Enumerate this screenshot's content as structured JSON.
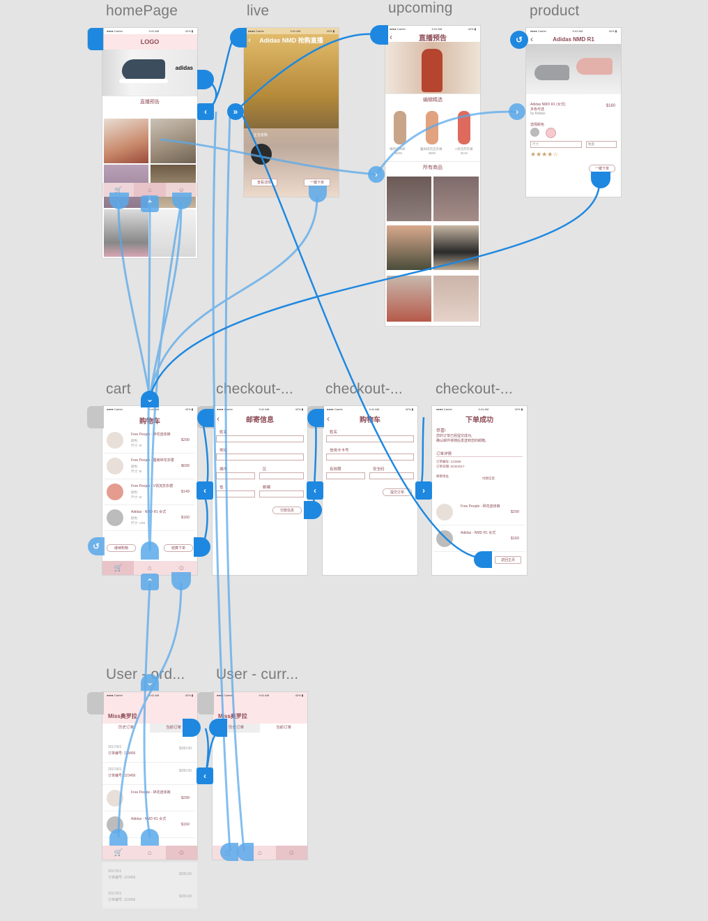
{
  "artboards": {
    "home": {
      "label": "homePage",
      "logo": "LOGO",
      "section": "直播预告",
      "nike_text": "adidas"
    },
    "live": {
      "label": "live",
      "title": "Adidas NMD 抢购直播",
      "now_live": "正在抢购",
      "view_details": "查看详情",
      "buy_now": "一键下单"
    },
    "upcoming": {
      "label": "upcoming",
      "title": "直播预告",
      "picks": "编辑精选",
      "all": "所有商品",
      "items": [
        {
          "name": "嘻哈连体裤",
          "price": "$299"
        },
        {
          "name": "露肩碎花连衣裙",
          "price": "$699"
        },
        {
          "name": "V领流苏衣裙",
          "price": "$149"
        }
      ]
    },
    "product": {
      "label": "product",
      "title": "Adidas NMD R1",
      "name": "Adidas NMD R1 (女式)",
      "variant": "多色可选",
      "brand": "by Adidas",
      "price": "$160",
      "color_label": "选择颜色",
      "size_ph": "尺寸",
      "qty_ph": "数量",
      "stars": "★★★★☆",
      "buy": "一键下单"
    },
    "cart": {
      "label": "cart",
      "title": "购物车",
      "items": [
        {
          "name": "Free People - 碎花连体裤",
          "color": "颜色:",
          "size": "尺寸: M",
          "qty": "数量: 1",
          "price": "$299"
        },
        {
          "name": "Free People - 露肩碎花衣裙",
          "color": "颜色:",
          "size": "尺寸: M",
          "qty": "数量: 1",
          "price": "$699"
        },
        {
          "name": "Free People - V领流苏衣裙",
          "color": "颜色:",
          "size": "尺寸: M",
          "qty": "数量: 1",
          "price": "$149"
        },
        {
          "name": "Adidas - NMD R1 女式",
          "color": "颜色:",
          "size": "尺寸: US6",
          "qty": "数量: 1",
          "price": "$160"
        }
      ],
      "continue": "继续购物",
      "checkout": "结算下单"
    },
    "checkout1": {
      "label": "checkout-...",
      "title": "邮寄信息",
      "name": "姓名",
      "address": "地址",
      "city": "城市",
      "district": "区",
      "province": "省",
      "zip": "邮编",
      "pay": "付款信息"
    },
    "checkout2": {
      "label": "checkout-...",
      "title": "购物车",
      "name": "姓名",
      "card": "信用卡卡号",
      "expiry": "有效期",
      "cvv": "安全码",
      "submit": "提交订单"
    },
    "checkout3": {
      "label": "checkout-...",
      "title": "下单成功",
      "congrats": "恭喜!",
      "msg1": "您的订单已经提交成功,",
      "msg2": "确认邮件将随后发送到您的邮箱。",
      "detail": "订单详情",
      "order_no": "订单编号: 123456",
      "order_date": "订单日期: 6/10/2017",
      "ship_addr": "邮寄地址",
      "pay_info": "付款信息",
      "items": [
        {
          "name": "Free People - 碎花连体裤",
          "price": "$299"
        },
        {
          "name": "Adidas - NMD R1 女式",
          "price": "$160"
        }
      ],
      "home": "返回主页"
    },
    "orders": {
      "label": "User - ord...",
      "user": "Miss奥罗拉",
      "tab_history": "历史订单",
      "tab_current": "当前订单",
      "orders": [
        {
          "date": "2017/5/1",
          "no": "订单编号: 123456",
          "price": "$200.00"
        },
        {
          "date": "2017/6/1",
          "no": "订单编号: 123456",
          "price": "$200.00"
        }
      ],
      "items": [
        {
          "name": "Free People - 碎花连体裤",
          "price": "$299"
        },
        {
          "name": "Adidas - NMD R1 女式",
          "price": "$160"
        }
      ],
      "faded": [
        {
          "date": "2017/5/1",
          "no": "订单编号: 123456",
          "price": "$200.00"
        },
        {
          "date": "2017/5/1",
          "no": "订单编号: 123456",
          "price": "$200.00"
        }
      ]
    },
    "current": {
      "label": "User - curr...",
      "user": "Miss奥罗拉",
      "tab_history": "历史订单",
      "tab_current": "当前订单"
    }
  },
  "status": {
    "carrier": "●●●● Carrier",
    "time": "9:41 AM",
    "battery": "42% ▮"
  },
  "colors": {
    "accent": "#1e88e0",
    "accent_light": "#5aa9ea",
    "brand": "#8c4b55",
    "pink": "#fce6e8"
  }
}
